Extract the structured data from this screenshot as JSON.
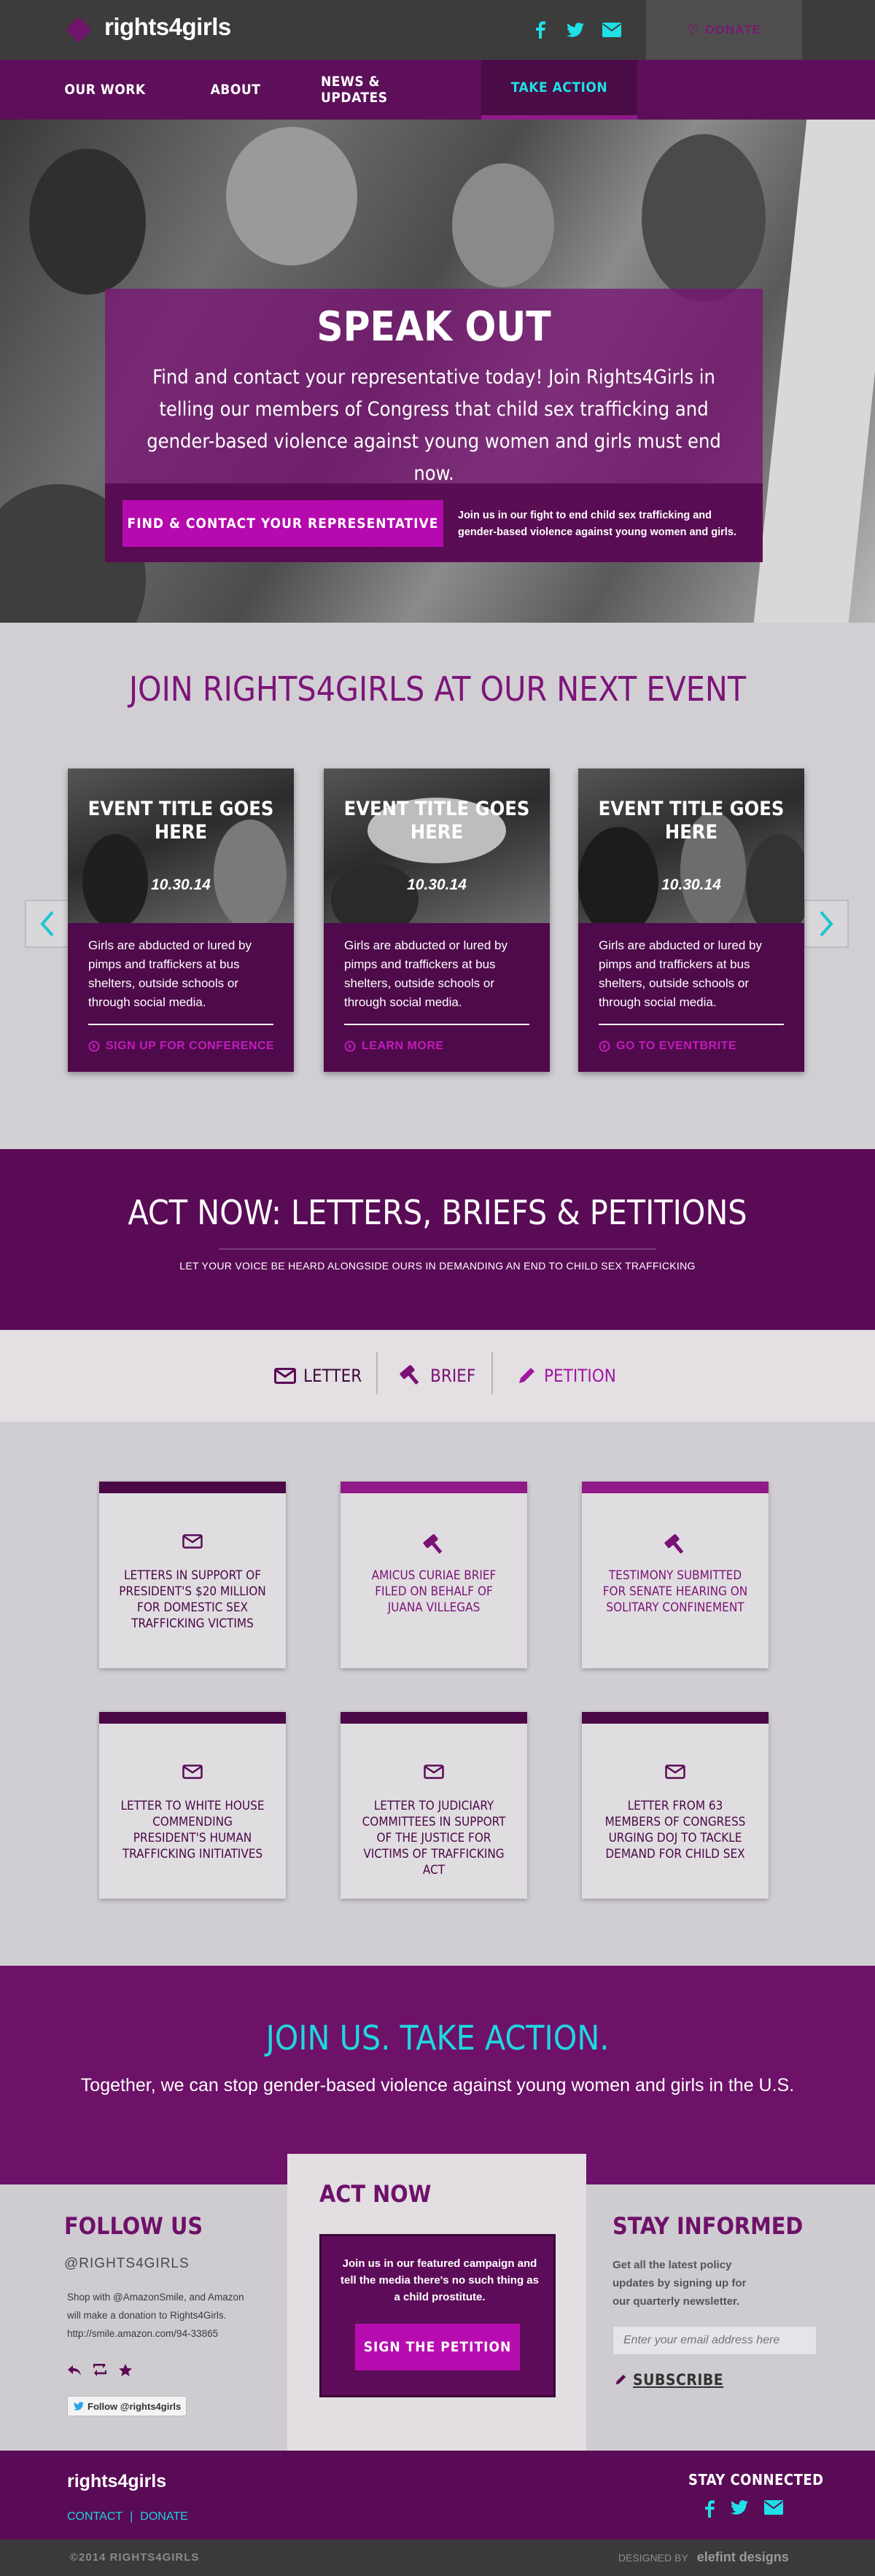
{
  "brand": {
    "name": "rights4girls",
    "accent": "#6e1169",
    "cyan": "#1ee0e6",
    "magenta": "#b50aad"
  },
  "topbar": {
    "donate_label": "DONATE",
    "icons": [
      "facebook-icon",
      "twitter-icon",
      "email-icon"
    ]
  },
  "nav": {
    "items": [
      {
        "label": "OUR WORK"
      },
      {
        "label": "ABOUT"
      },
      {
        "label": "NEWS & UPDATES"
      },
      {
        "label": "TAKE ACTION",
        "active": true
      }
    ]
  },
  "hero": {
    "title": "SPEAK OUT",
    "text": "Find and contact your representative today! Join Rights4Girls in telling our members of Congress that child sex trafficking and gender-based violence against young women and girls must end now.",
    "cta": "FIND & CONTACT YOUR REPRESENTATIVE",
    "side_text": "Join us in our fight to end child sex trafficking and gender-based violence against young women and girls."
  },
  "events": {
    "title": "JOIN RIGHTS4GIRLS AT OUR NEXT EVENT",
    "cards": [
      {
        "title": "EVENT TITLE GOES HERE",
        "date": "10.30.14",
        "text": "Girls are abducted or lured by pimps and traffickers at bus shelters, outside schools or through social media.",
        "link": "SIGN UP FOR CONFERENCE"
      },
      {
        "title": "EVENT TITLE GOES HERE",
        "date": "10.30.14",
        "text": "Girls are abducted or lured by pimps and traffickers at bus shelters, outside schools or through social media.",
        "link": "LEARN MORE"
      },
      {
        "title": "EVENT TITLE GOES HERE",
        "date": "10.30.14",
        "text": "Girls are abducted or lured by pimps and traffickers at bus shelters, outside schools or through social media.",
        "link": "GO TO EVENTBRITE"
      }
    ]
  },
  "actnow": {
    "title": "ACT NOW: LETTERS, BRIEFS & PETITIONS",
    "subtitle": "LET YOUR VOICE BE HEARD ALONGSIDE OURS IN DEMANDING AN END TO CHILD SEX TRAFFICKING"
  },
  "tabs": [
    {
      "label": "LETTER",
      "icon": "envelope-icon"
    },
    {
      "label": "BRIEF",
      "icon": "gavel-icon"
    },
    {
      "label": "PETITION",
      "icon": "pencil-icon"
    }
  ],
  "docs": [
    {
      "icon": "envelope-icon",
      "text": "LETTERS IN SUPPORT OF PRESIDENT'S $20 MILLION FOR DOMESTIC SEX TRAFFICKING VICTIMS"
    },
    {
      "icon": "gavel-icon",
      "text": "AMICUS CURIAE BRIEF FILED ON BEHALF OF JUANA VILLEGAS"
    },
    {
      "icon": "gavel-icon",
      "text": "TESTIMONY SUBMITTED FOR SENATE HEARING ON SOLITARY CONFINEMENT"
    },
    {
      "icon": "envelope-icon",
      "text": "LETTER TO WHITE HOUSE COMMENDING PRESIDENT'S HUMAN TRAFFICKING INITIATIVES"
    },
    {
      "icon": "envelope-icon",
      "text": "LETTER TO JUDICIARY COMMITTEES IN SUPPORT OF THE JUSTICE FOR VICTIMS OF TRAFFICKING ACT"
    },
    {
      "icon": "envelope-icon",
      "text": "LETTER FROM 63 MEMBERS OF CONGRESS URGING DOJ TO TACKLE DEMAND FOR CHILD SEX"
    }
  ],
  "join": {
    "title": "JOIN US. TAKE ACTION.",
    "text": "Together, we can stop gender-based violence against young women and girls in the U.S."
  },
  "follow": {
    "title": "FOLLOW US",
    "handle": "@RIGHTS4GIRLS",
    "tweet": "Shop with @AmazonSmile, and Amazon will make a donation to Rights4Girls. http://smile.amazon.com/94-33865",
    "button": "Follow @rights4girls"
  },
  "actcol": {
    "title": "ACT NOW",
    "text": "Join us in our featured campaign and tell the media there's no such thing as a child prostitute.",
    "button": "SIGN THE PETITION"
  },
  "inform": {
    "title": "STAY INFORMED",
    "text": "Get all the latest policy updates by signing up for our quarterly newsletter.",
    "placeholder": "Enter your email address here",
    "subscribe": "SUBSCRIBE"
  },
  "footer": {
    "logo": "rights4girls",
    "links": [
      "CONTACT",
      "DONATE"
    ],
    "separator": "|",
    "stay": "STAY CONNECTED",
    "copyright": "©2014 RIGHTS4GIRLS",
    "designed_by": "DESIGNED BY",
    "designer": "elefint designs"
  }
}
